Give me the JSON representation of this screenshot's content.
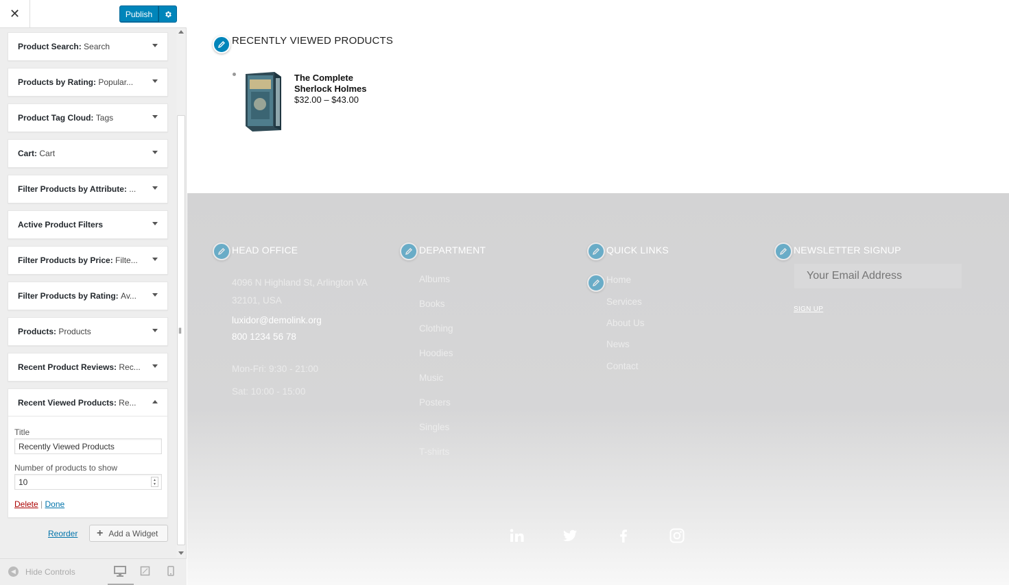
{
  "header": {
    "close_icon": "close-icon",
    "publish_label": "Publish",
    "publish_settings_icon": "gear-icon",
    "accent": "#0085ba"
  },
  "widgets": [
    {
      "name": "Product Search:",
      "title": "Search"
    },
    {
      "name": "Products by Rating:",
      "title": "Popular..."
    },
    {
      "name": "Product Tag Cloud:",
      "title": "Tags"
    },
    {
      "name": "Cart:",
      "title": "Cart"
    },
    {
      "name": "Filter Products by Attribute:",
      "title": "..."
    },
    {
      "name": "Active Product Filters",
      "title": ""
    },
    {
      "name": "Filter Products by Price:",
      "title": "Filte..."
    },
    {
      "name": "Filter Products by Rating:",
      "title": "Av..."
    },
    {
      "name": "Products:",
      "title": "Products"
    },
    {
      "name": "Recent Product Reviews:",
      "title": "Rec..."
    }
  ],
  "open_widget": {
    "name": "Recent Viewed Products:",
    "title": "Re...",
    "title_label": "Title",
    "title_value": "Recently Viewed Products",
    "count_label": "Number of products to show",
    "count_value": "10",
    "delete_label": "Delete",
    "separator": "|",
    "done_label": "Done"
  },
  "sidebar_actions": {
    "reorder_label": "Reorder",
    "add_widget_label": "Add a Widget"
  },
  "sidebar_footer": {
    "hide_controls_label": "Hide Controls",
    "devices": [
      "desktop-icon",
      "tablet-icon",
      "mobile-icon"
    ]
  },
  "recently_viewed": {
    "heading": "RECENTLY VIEWED PRODUCTS",
    "product_name": "The Complete Sherlock Holmes",
    "product_price": "$32.00 – $43.00"
  },
  "footer": {
    "head_office": {
      "heading": "HEAD OFFICE",
      "address_line1": "4096 N Highland St, Arlington VA",
      "address_line2": "32101, USA",
      "email": "luxidor@demolink.org",
      "phone": "800 1234 56 78",
      "hours1": "Mon-Fri: 9:30 - 21:00",
      "hours2": "Sat: 10:00 - 15:00"
    },
    "department": {
      "heading": "DEPARTMENT",
      "links": [
        "Albums",
        "Books",
        "Clothing",
        "Hoodies",
        "Music",
        "Posters",
        "Singles",
        "T-shirts"
      ]
    },
    "quick_links": {
      "heading": "QUICK LINKS",
      "links": [
        "Home",
        "Services",
        "About Us",
        "News",
        "Contact"
      ]
    },
    "newsletter": {
      "heading": "NEWSLETTER SIGNUP",
      "email_placeholder": "Your Email Address",
      "signup_label": "SIGN UP"
    },
    "social": [
      "linkedin-icon",
      "twitter-icon",
      "facebook-icon",
      "instagram-icon"
    ]
  }
}
